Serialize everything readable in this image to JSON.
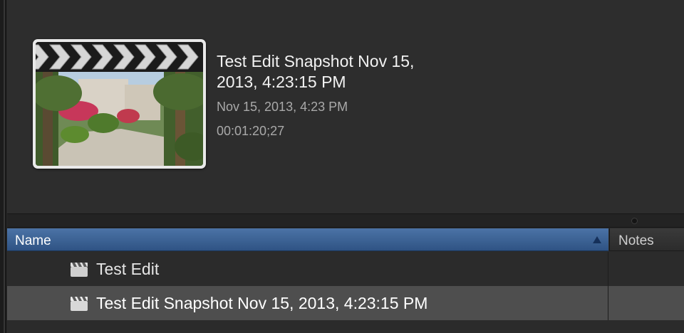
{
  "inspector": {
    "title": "Test Edit Snapshot Nov 15, 2013, 4:23:15 PM",
    "date": "Nov 15, 2013, 4:23 PM",
    "duration": "00:01:20;27"
  },
  "list": {
    "columns": {
      "name": "Name",
      "notes": "Notes"
    },
    "sort": "ascending",
    "rows": [
      {
        "label": "Test Edit",
        "icon": "clapperboard-icon",
        "selected": false
      },
      {
        "label": "Test Edit Snapshot Nov 15, 2013, 4:23:15 PM",
        "icon": "clapperboard-icon",
        "selected": true
      }
    ]
  },
  "colors": {
    "header_blue": "#3d639a",
    "selected_row": "#4e4e4e",
    "background": "#2b2b2b"
  }
}
